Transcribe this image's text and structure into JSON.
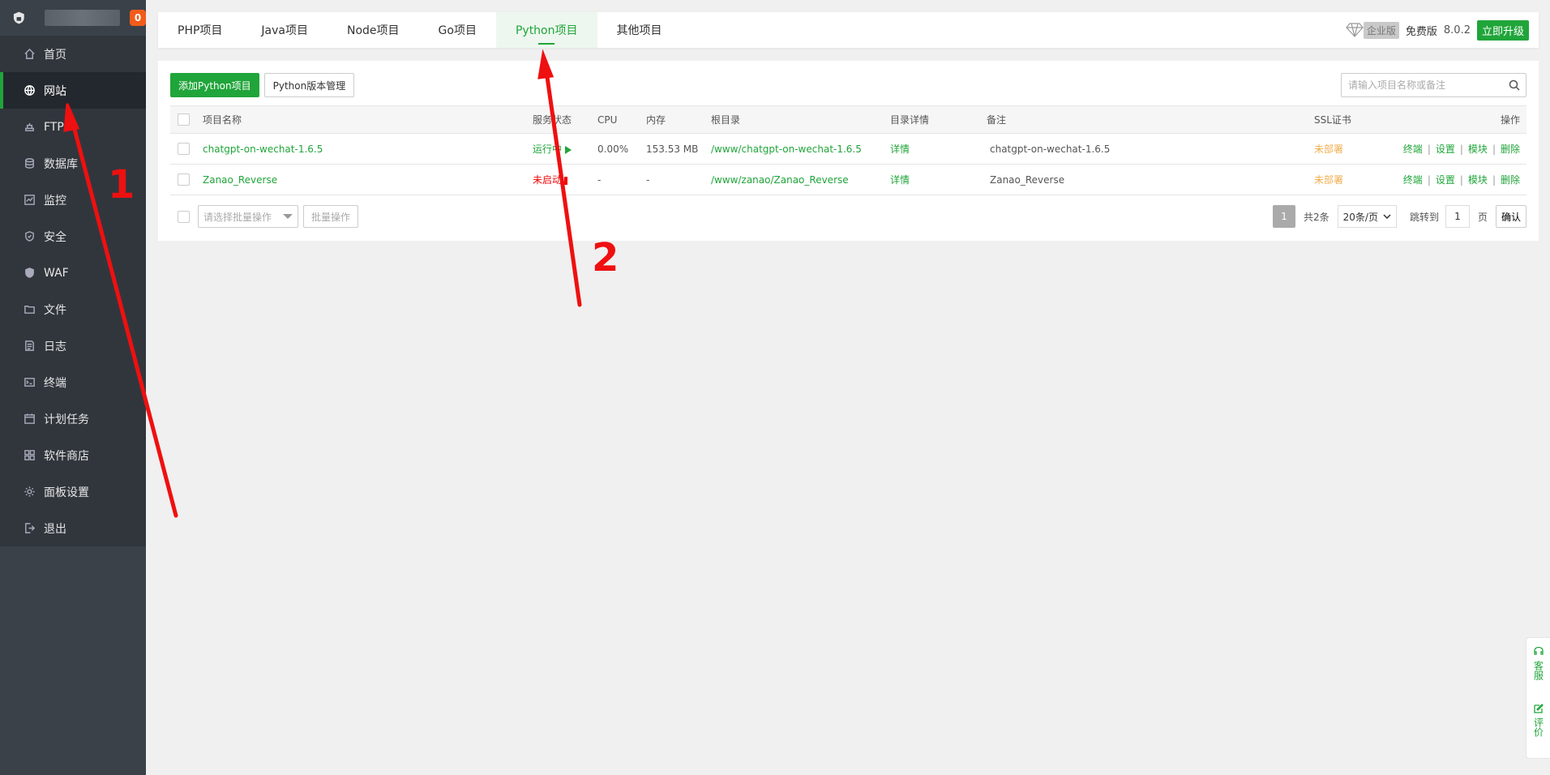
{
  "sidebar": {
    "badge": "0",
    "items": [
      {
        "label": "首页",
        "icon": "home-icon"
      },
      {
        "label": "网站",
        "icon": "globe-icon",
        "active": true
      },
      {
        "label": "FTP",
        "icon": "ftp-icon"
      },
      {
        "label": "数据库",
        "icon": "database-icon"
      },
      {
        "label": "监控",
        "icon": "monitor-icon"
      },
      {
        "label": "安全",
        "icon": "shield-icon"
      },
      {
        "label": "WAF",
        "icon": "waf-icon"
      },
      {
        "label": "文件",
        "icon": "folder-icon"
      },
      {
        "label": "日志",
        "icon": "log-icon"
      },
      {
        "label": "终端",
        "icon": "terminal-icon"
      },
      {
        "label": "计划任务",
        "icon": "calendar-icon"
      },
      {
        "label": "软件商店",
        "icon": "apps-icon"
      },
      {
        "label": "面板设置",
        "icon": "gear-icon"
      },
      {
        "label": "退出",
        "icon": "logout-icon"
      }
    ]
  },
  "tabs": [
    "PHP项目",
    "Java项目",
    "Node项目",
    "Go项目",
    "Python项目",
    "其他项目"
  ],
  "active_tab": "Python项目",
  "top_right": {
    "edition_tag": "企业版",
    "plan": "免费版",
    "version": "8.0.2",
    "upgrade": "立即升级"
  },
  "toolbar": {
    "add_python": "添加Python项目",
    "version_manage": "Python版本管理"
  },
  "search": {
    "placeholder": "请输入项目名称或备注"
  },
  "table": {
    "headers": [
      "项目名称",
      "服务状态",
      "CPU",
      "内存",
      "根目录",
      "目录详情",
      "备注",
      "SSL证书",
      "操作"
    ],
    "rows": [
      {
        "name": "chatgpt-on-wechat-1.6.5",
        "status": "运行中",
        "status_color": "#20a53a",
        "cpu": "0.00%",
        "memory": "153.53 MB",
        "root": "/www/chatgpt-on-wechat-1.6.5",
        "detail": "详情",
        "remark": "chatgpt-on-wechat-1.6.5",
        "ssl": "未部署",
        "ops": [
          "终端",
          "设置",
          "模块",
          "删除"
        ]
      },
      {
        "name": "Zanao_Reverse",
        "status": "未启动",
        "status_color": "#ef0808",
        "cpu": "-",
        "memory": "-",
        "root": "/www/zanao/Zanao_Reverse",
        "detail": "详情",
        "remark": "Zanao_Reverse",
        "ssl": "未部署",
        "ops": [
          "终端",
          "设置",
          "模块",
          "删除"
        ]
      }
    ]
  },
  "footer": {
    "batch_placeholder": "请选择批量操作",
    "batch_button": "批量操作",
    "page_current": "1",
    "total": "共2条",
    "page_size": "20条/页",
    "jump_label": "跳转到",
    "jump_value": "1",
    "page_unit": "页",
    "confirm": "确认"
  },
  "float_help": {
    "service": "客服",
    "review": "评价"
  },
  "annotations": {
    "label_1": "1",
    "label_2": "2",
    "color": "#ef1010"
  },
  "colors": {
    "brand_green": "#20a53a",
    "sidebar_bg": "#3b4148",
    "error_red": "#ef0808",
    "warn_orange": "#f0ad4e"
  }
}
